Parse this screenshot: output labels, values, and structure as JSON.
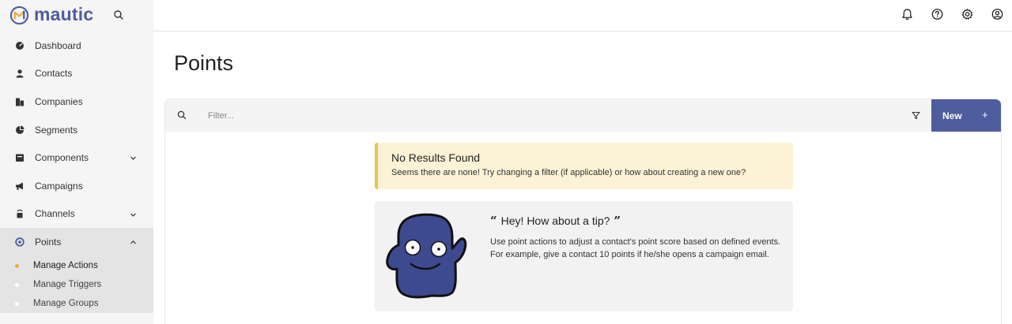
{
  "app": {
    "logo_text": "mautic",
    "brand_color": "#4e5d9d",
    "accent_color": "#f0a93b"
  },
  "topbar": {
    "icons": [
      "bell-icon",
      "help-icon",
      "gear-icon",
      "user-icon"
    ]
  },
  "sidebar": {
    "items": [
      {
        "label": "Dashboard",
        "icon": "dashboard-icon"
      },
      {
        "label": "Contacts",
        "icon": "contact-icon"
      },
      {
        "label": "Companies",
        "icon": "building-icon"
      },
      {
        "label": "Segments",
        "icon": "pie-icon"
      },
      {
        "label": "Components",
        "icon": "component-icon",
        "chevron": "down"
      },
      {
        "label": "Campaigns",
        "icon": "megaphone-icon"
      },
      {
        "label": "Channels",
        "icon": "channel-icon",
        "chevron": "down"
      },
      {
        "label": "Points",
        "icon": "points-icon",
        "chevron": "up",
        "active": true
      }
    ],
    "sub_items": [
      {
        "label": "Manage Actions",
        "current": true
      },
      {
        "label": "Manage Triggers"
      },
      {
        "label": "Manage Groups"
      }
    ]
  },
  "main": {
    "title": "Points",
    "toolbar": {
      "filter_placeholder": "Filter...",
      "new_label": "New",
      "new_plus": "+"
    },
    "alert": {
      "title": "No Results Found",
      "text": "Seems there are none! Try changing a filter (if applicable) or how about creating a new one?"
    },
    "tip": {
      "open_quote": "“",
      "heading": "Hey! How about a tip?",
      "close_quote": "”",
      "body": "Use point actions to adjust a contact's point score based on defined events. For example, give a contact 10 points if he/she opens a campaign email."
    }
  }
}
